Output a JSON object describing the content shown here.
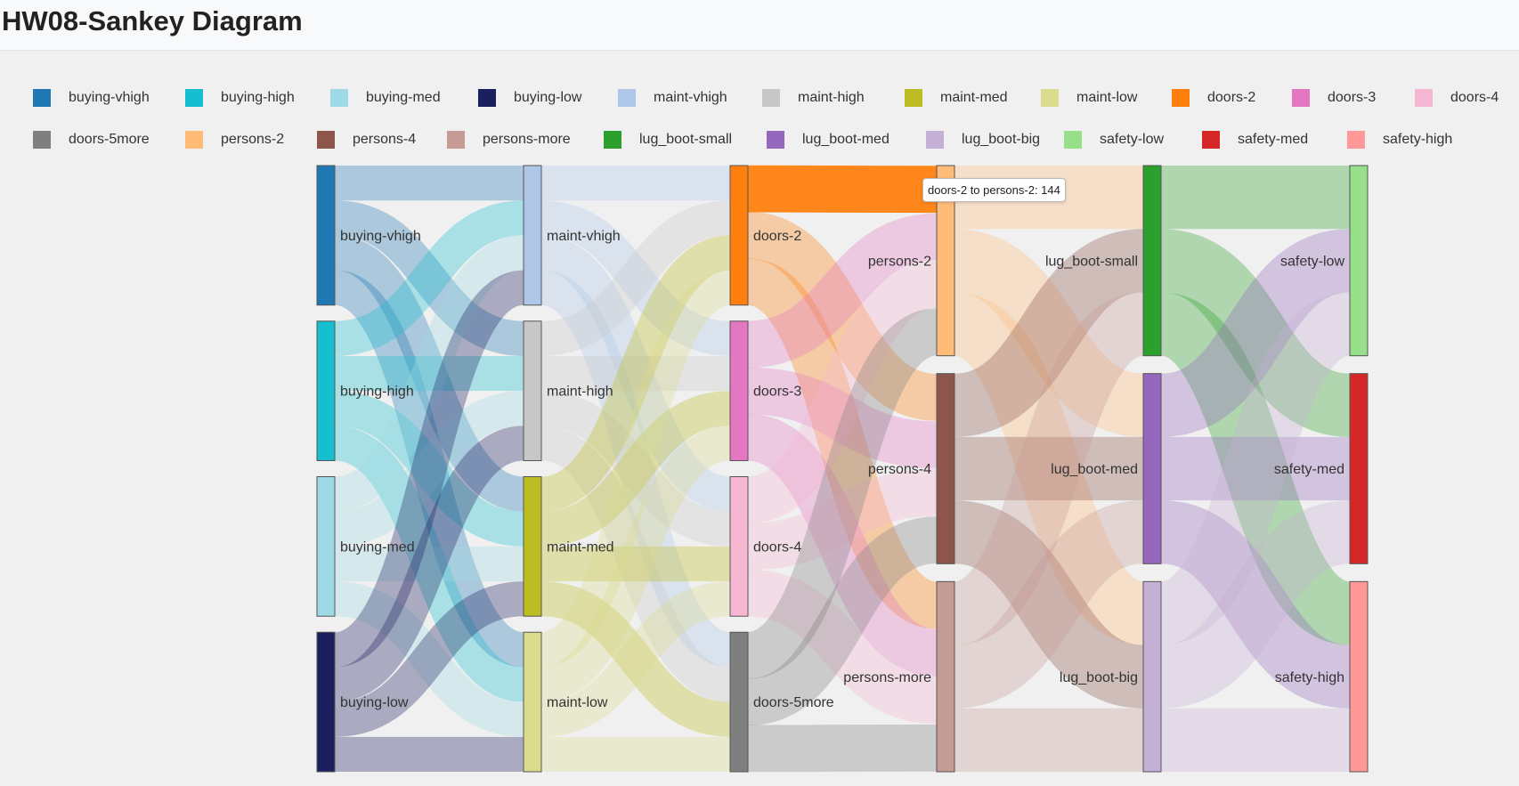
{
  "page": {
    "title": "HW08-Sankey Diagram"
  },
  "nodes": [
    {
      "id": "buying-vhigh",
      "color": "#1f77b4"
    },
    {
      "id": "buying-high",
      "color": "#17becf"
    },
    {
      "id": "buying-med",
      "color": "#9edae5"
    },
    {
      "id": "buying-low",
      "color": "#1a1f5e"
    },
    {
      "id": "maint-vhigh",
      "color": "#aec7e8"
    },
    {
      "id": "maint-high",
      "color": "#c7c7c7"
    },
    {
      "id": "maint-med",
      "color": "#bcbd22"
    },
    {
      "id": "maint-low",
      "color": "#dbdb8d"
    },
    {
      "id": "doors-2",
      "color": "#ff7f0e"
    },
    {
      "id": "doors-3",
      "color": "#e377c2"
    },
    {
      "id": "doors-4",
      "color": "#f7b6d2"
    },
    {
      "id": "doors-5more",
      "color": "#7f7f7f"
    },
    {
      "id": "persons-2",
      "color": "#ffbb78"
    },
    {
      "id": "persons-4",
      "color": "#8c564b"
    },
    {
      "id": "persons-more",
      "color": "#c49c94"
    },
    {
      "id": "lug_boot-small",
      "color": "#2ca02c"
    },
    {
      "id": "lug_boot-med",
      "color": "#9467bd"
    },
    {
      "id": "lug_boot-big",
      "color": "#c5b0d5"
    },
    {
      "id": "safety-low",
      "color": "#98df8a"
    },
    {
      "id": "safety-med",
      "color": "#d62728"
    },
    {
      "id": "safety-high",
      "color": "#ff9896"
    }
  ],
  "tooltip": {
    "text": "doors-2 to persons-2: 144"
  }
}
